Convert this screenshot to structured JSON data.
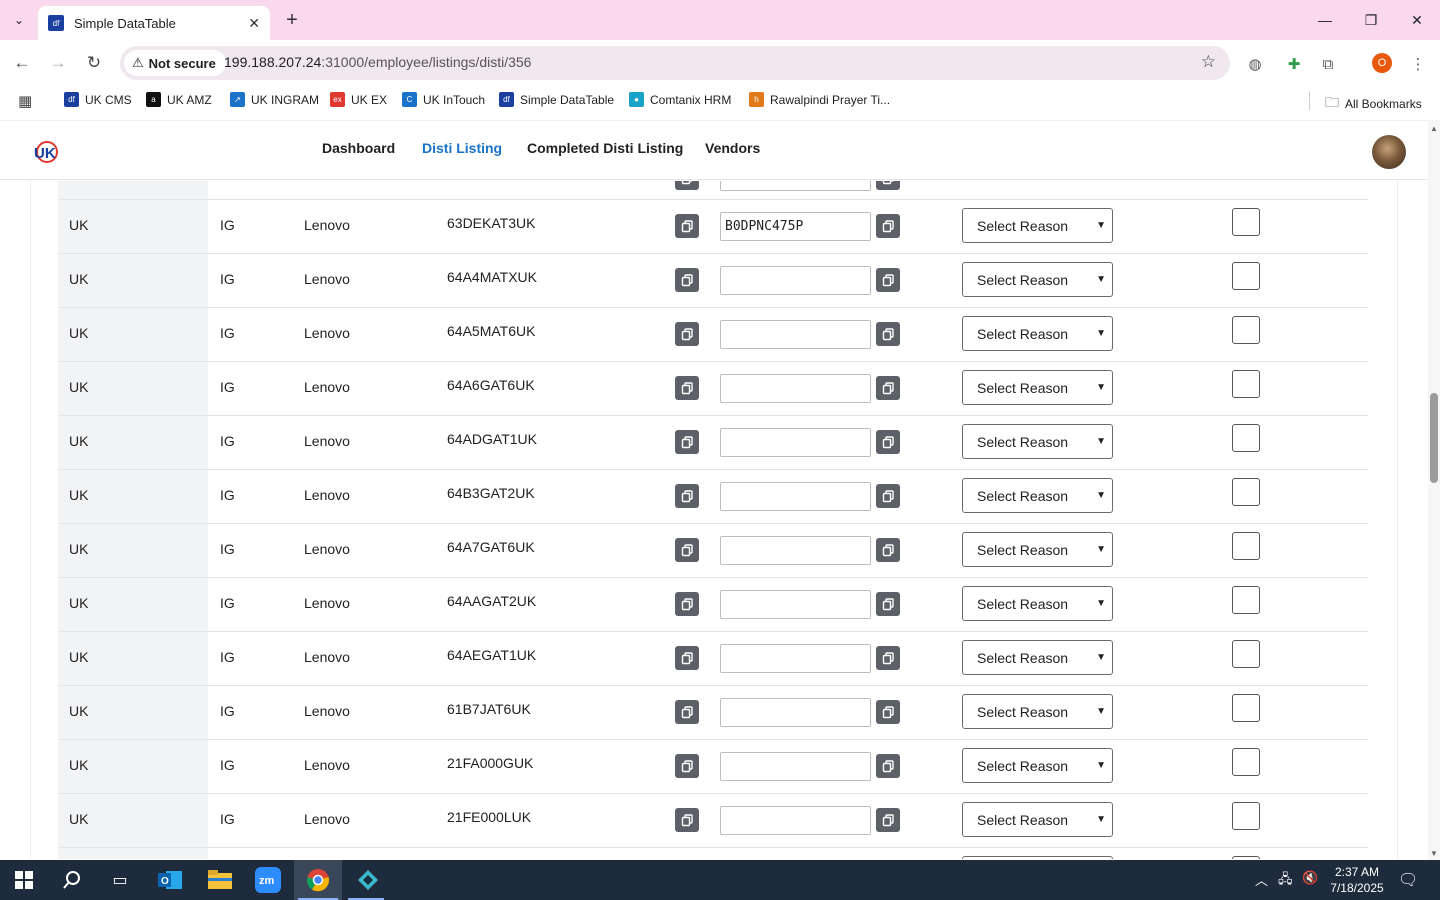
{
  "browser": {
    "tab_title": "Simple DataTable",
    "tab_favicon": "df",
    "url_host": "199.188.207.24",
    "url_path": ":31000/employee/listings/disti/356",
    "security_label": "Not secure",
    "profile_initial": "O"
  },
  "bookmarks": [
    {
      "label": "UK CMS",
      "icon": "uk-cms-icon",
      "color": "#1a3f9e",
      "glyph": "df"
    },
    {
      "label": "UK AMZ",
      "icon": "amazon-icon",
      "color": "#111111",
      "glyph": "a"
    },
    {
      "label": "UK INGRAM",
      "icon": "ingram-icon",
      "color": "#1a73c8",
      "glyph": "↗"
    },
    {
      "label": "UK EX",
      "icon": "ex-icon",
      "color": "#e03a2f",
      "glyph": "ex"
    },
    {
      "label": "UK InTouch",
      "icon": "intouch-icon",
      "color": "#1a73c8",
      "glyph": "C"
    },
    {
      "label": "Simple DataTable",
      "icon": "datatable-icon",
      "color": "#1a3f9e",
      "glyph": "df"
    },
    {
      "label": "Comtanix HRM",
      "icon": "comtanix-icon",
      "color": "#1aa3c8",
      "glyph": "●"
    },
    {
      "label": "Rawalpindi Prayer Ti...",
      "icon": "prayer-icon",
      "color": "#e07a1a",
      "glyph": "h"
    }
  ],
  "all_bookmarks_label": "All Bookmarks",
  "nav": {
    "dashboard": "Dashboard",
    "disti_listing": "Disti Listing",
    "completed": "Completed Disti Listing",
    "vendors": "Vendors"
  },
  "reason_placeholder": "Select Reason",
  "rows": [
    {
      "country": "UK",
      "disti": "IG",
      "brand": "Lenovo",
      "sku": "63DEKAT3UK",
      "asin": "B0DPNC475P"
    },
    {
      "country": "UK",
      "disti": "IG",
      "brand": "Lenovo",
      "sku": "64A4MATXUK",
      "asin": ""
    },
    {
      "country": "UK",
      "disti": "IG",
      "brand": "Lenovo",
      "sku": "64A5MAT6UK",
      "asin": ""
    },
    {
      "country": "UK",
      "disti": "IG",
      "brand": "Lenovo",
      "sku": "64A6GAT6UK",
      "asin": ""
    },
    {
      "country": "UK",
      "disti": "IG",
      "brand": "Lenovo",
      "sku": "64ADGAT1UK",
      "asin": ""
    },
    {
      "country": "UK",
      "disti": "IG",
      "brand": "Lenovo",
      "sku": "64B3GAT2UK",
      "asin": ""
    },
    {
      "country": "UK",
      "disti": "IG",
      "brand": "Lenovo",
      "sku": "64A7GAT6UK",
      "asin": ""
    },
    {
      "country": "UK",
      "disti": "IG",
      "brand": "Lenovo",
      "sku": "64AAGAT2UK",
      "asin": ""
    },
    {
      "country": "UK",
      "disti": "IG",
      "brand": "Lenovo",
      "sku": "64AEGAT1UK",
      "asin": ""
    },
    {
      "country": "UK",
      "disti": "IG",
      "brand": "Lenovo",
      "sku": "61B7JAT6UK",
      "asin": ""
    },
    {
      "country": "UK",
      "disti": "IG",
      "brand": "Lenovo",
      "sku": "21FA000GUK",
      "asin": ""
    },
    {
      "country": "UK",
      "disti": "IG",
      "brand": "Lenovo",
      "sku": "21FE000LUK",
      "asin": ""
    }
  ],
  "taskbar": {
    "time": "2:37 AM",
    "date": "7/18/2025"
  }
}
